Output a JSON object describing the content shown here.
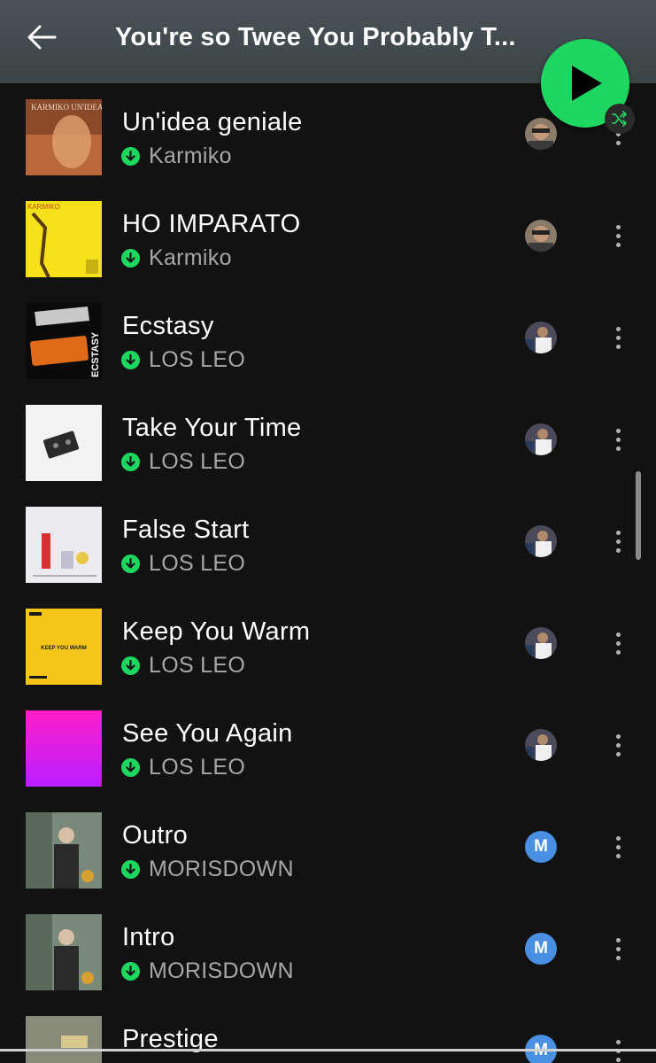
{
  "header": {
    "title": "You're so Twee You Probably T...",
    "back_icon": "arrow-left-icon"
  },
  "controls": {
    "play_icon": "play-icon",
    "shuffle_icon": "shuffle-icon",
    "accent_color": "#1ed760"
  },
  "tracks": [
    {
      "title": "Un'idea geniale",
      "artist": "Karmiko",
      "cover_text": "KARMIKO UN'IDEA GENIALE",
      "added_by": "photo-avatar"
    },
    {
      "title": "HO IMPARATO",
      "artist": "Karmiko",
      "cover_text": "KARMIKO",
      "added_by": "photo-avatar"
    },
    {
      "title": "Ecstasy",
      "artist": "LOS LEO",
      "cover_text": "ECSTASY",
      "added_by": "photo-avatar"
    },
    {
      "title": "Take Your Time",
      "artist": "LOS LEO",
      "added_by": "photo-avatar"
    },
    {
      "title": "False Start",
      "artist": "LOS LEO",
      "added_by": "photo-avatar"
    },
    {
      "title": "Keep You Warm",
      "artist": "LOS LEO",
      "cover_text": "KEEP YOU WARM",
      "added_by": "photo-avatar"
    },
    {
      "title": "See You Again",
      "artist": "LOS LEO",
      "added_by": "photo-avatar"
    },
    {
      "title": "Outro",
      "artist": "MORISDOWN",
      "added_by": "M"
    },
    {
      "title": "Intro",
      "artist": "MORISDOWN",
      "added_by": "M"
    },
    {
      "title": "Prestige",
      "artist": "",
      "added_by": "M"
    }
  ]
}
